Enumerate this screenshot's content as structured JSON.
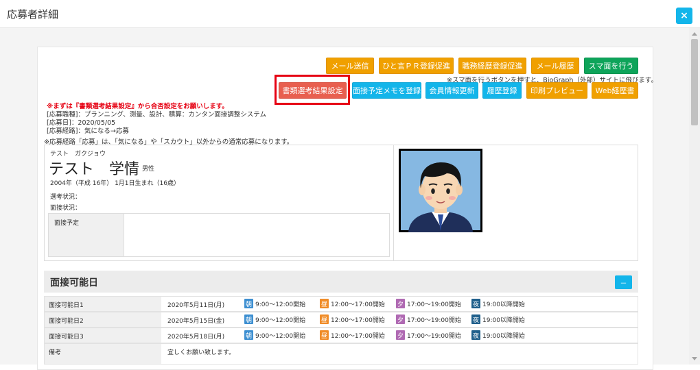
{
  "window": {
    "title": "応募者詳細",
    "close_label": "×"
  },
  "toolbar_row1": [
    {
      "label": "メール送信",
      "color": "#f0a000"
    },
    {
      "label": "ひと言ＰＲ登録促進",
      "color": "#f0a000"
    },
    {
      "label": "職務経歴登録促進",
      "color": "#f0a000"
    },
    {
      "label": "メール履歴",
      "color": "#f0a000"
    },
    {
      "label": "スマ面を行う",
      "color": "#0ea45a"
    }
  ],
  "smamen_note": "※スマ面を行うボタンを押すと、BioGraph（外部）サイトに飛びます。",
  "toolbar_row2": [
    {
      "label": "書類選考結果設定",
      "color": "#e85f4f"
    },
    {
      "label": "面接予定メモを登録",
      "color": "#13b5ea"
    },
    {
      "label": "会員情報更新",
      "color": "#13b5ea"
    },
    {
      "label": "履歴登録",
      "color": "#13b5ea"
    },
    {
      "label": "印刷プレビュー",
      "color": "#f0a000"
    },
    {
      "label": "Web経歴書",
      "color": "#f0a000"
    }
  ],
  "notice": {
    "warning": "※まずは『書類選考結果設定』から合否設定をお願いします。",
    "job": "[応募職種]：プランニング、測量、設計、積算：カンタン面接調整システム",
    "date": "[応募日]：2020/05/05",
    "route": "[応募経路]：気になる→応募",
    "footnote": "※応募経路「応募」は、「気になる」や「スカウト」以外からの通常応募になります。"
  },
  "profile": {
    "kana": "テスト　ガクジョウ",
    "name": "テスト　学情",
    "gender": "男性",
    "birth": "2004年（平成 16年） 1月1日生まれ（16歳）",
    "selection_status_label": "選考状況：",
    "interview_status_label": "面接状況：",
    "meeting_plan_label": "面接予定"
  },
  "availability": {
    "title": "面接可能日",
    "collapse_label": "－",
    "rows": [
      {
        "label": "面接可能日1",
        "date": "2020年5月11日(月)"
      },
      {
        "label": "面接可能日2",
        "date": "2020年5月15日(金)"
      },
      {
        "label": "面接可能日3",
        "date": "2020年5月18日(月)"
      }
    ],
    "slots": [
      {
        "badge": "朝",
        "text": "9:00～12:00開始",
        "color": "#3d8fd1"
      },
      {
        "badge": "昼",
        "text": "12:00～17:00開始",
        "color": "#f08c28"
      },
      {
        "badge": "夕",
        "text": "17:00～19:00開始",
        "color": "#b06ab3"
      },
      {
        "badge": "夜",
        "text": "19:00以降開始",
        "color": "#1f5f8b"
      }
    ],
    "remarks_label": "備考",
    "remarks_value": "宜しくお願い致します。"
  }
}
